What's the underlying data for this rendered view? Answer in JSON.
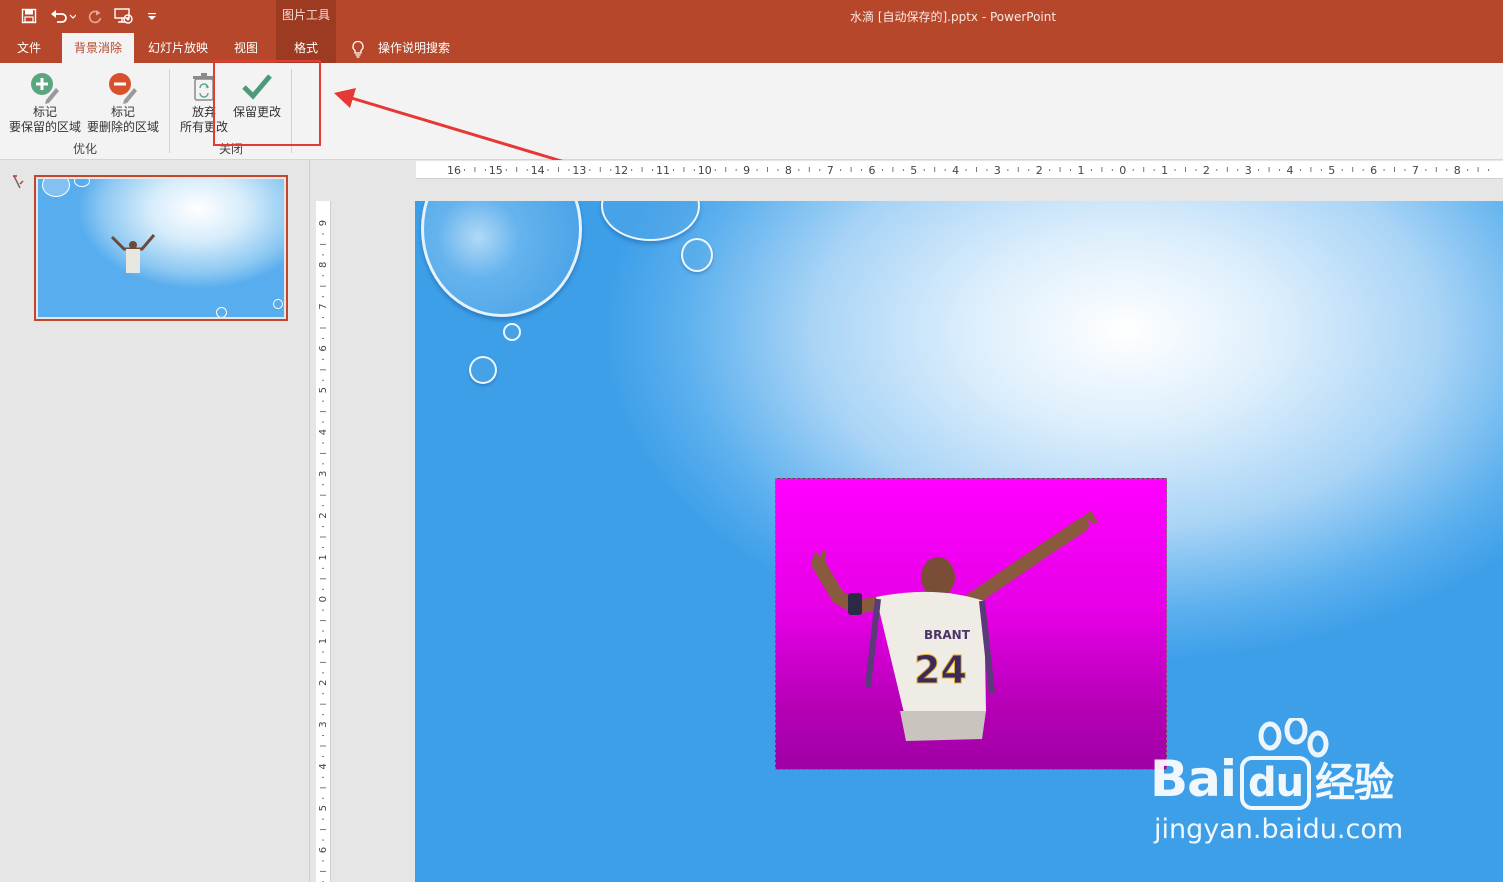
{
  "titlebar": {
    "title": "水滴 [自动保存的].pptx  -  PowerPoint",
    "context_label": "图片工具",
    "accent": "#b7472a",
    "qat_icons": [
      "save-icon",
      "undo-icon",
      "redo-icon",
      "present-from-start-icon",
      "customize-qat-icon"
    ]
  },
  "tabs": [
    {
      "label": "文件"
    },
    {
      "label": "背景消除",
      "active": true
    },
    {
      "label": "幻灯片放映"
    },
    {
      "label": "视图"
    },
    {
      "label": "格式"
    }
  ],
  "tell_me": {
    "label": "操作说明搜索",
    "icon": "lightbulb-icon"
  },
  "ribbon": {
    "groups": [
      {
        "label": "优化",
        "buttons": [
          {
            "line1": "标记",
            "line2": "要保留的区域",
            "icon": "mark-keep-icon"
          },
          {
            "line1": "标记",
            "line2": "要删除的区域",
            "icon": "mark-remove-icon"
          }
        ]
      },
      {
        "label": "关闭",
        "buttons": [
          {
            "line1": "放弃",
            "line2": "所有更改",
            "icon": "discard-icon"
          },
          {
            "line1": "保留更改",
            "line2": "",
            "icon": "checkmark-icon"
          }
        ]
      }
    ]
  },
  "annotation": {
    "highlight_color": "#e53935"
  },
  "slides": [
    {
      "number": "1",
      "selected": true
    }
  ],
  "rulers": {
    "horizontal": [
      "16",
      "15",
      "14",
      "13",
      "12",
      "11",
      "10",
      "9",
      "8",
      "7",
      "6",
      "5",
      "4",
      "3",
      "2",
      "1",
      "0",
      "1",
      "2",
      "3",
      "4",
      "5",
      "6",
      "7",
      "8"
    ],
    "vertical": [
      "9",
      "8",
      "7",
      "6",
      "5",
      "4",
      "3",
      "2",
      "1",
      "0",
      "1",
      "2",
      "3",
      "4",
      "5",
      "6"
    ]
  },
  "picture": {
    "jersey_name": "BRANT",
    "jersey_number": "24"
  },
  "watermark": {
    "brand": "Bai",
    "brand2": "du",
    "suffix": "经验",
    "url": "jingyan.baidu.com"
  }
}
